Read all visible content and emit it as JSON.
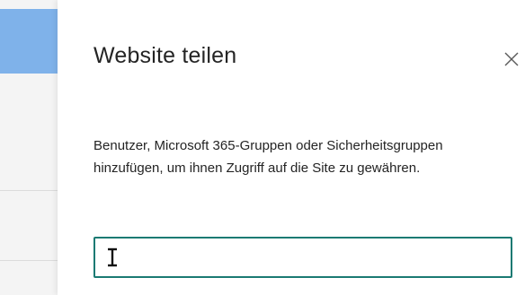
{
  "dialog": {
    "title": "Website teilen",
    "close_icon": "close-icon",
    "description": "Benutzer, Microsoft 365-Gruppen oder Sicherheitsgruppen hinzufügen, um ihnen Zugriff auf die Site zu gewähren.",
    "search_input": {
      "value": "",
      "placeholder": "",
      "cursor_icon": "text-cursor-icon"
    }
  },
  "colors": {
    "accent": "#1a7a73",
    "background_accent": "#7fb2ea",
    "text": "#242424"
  }
}
